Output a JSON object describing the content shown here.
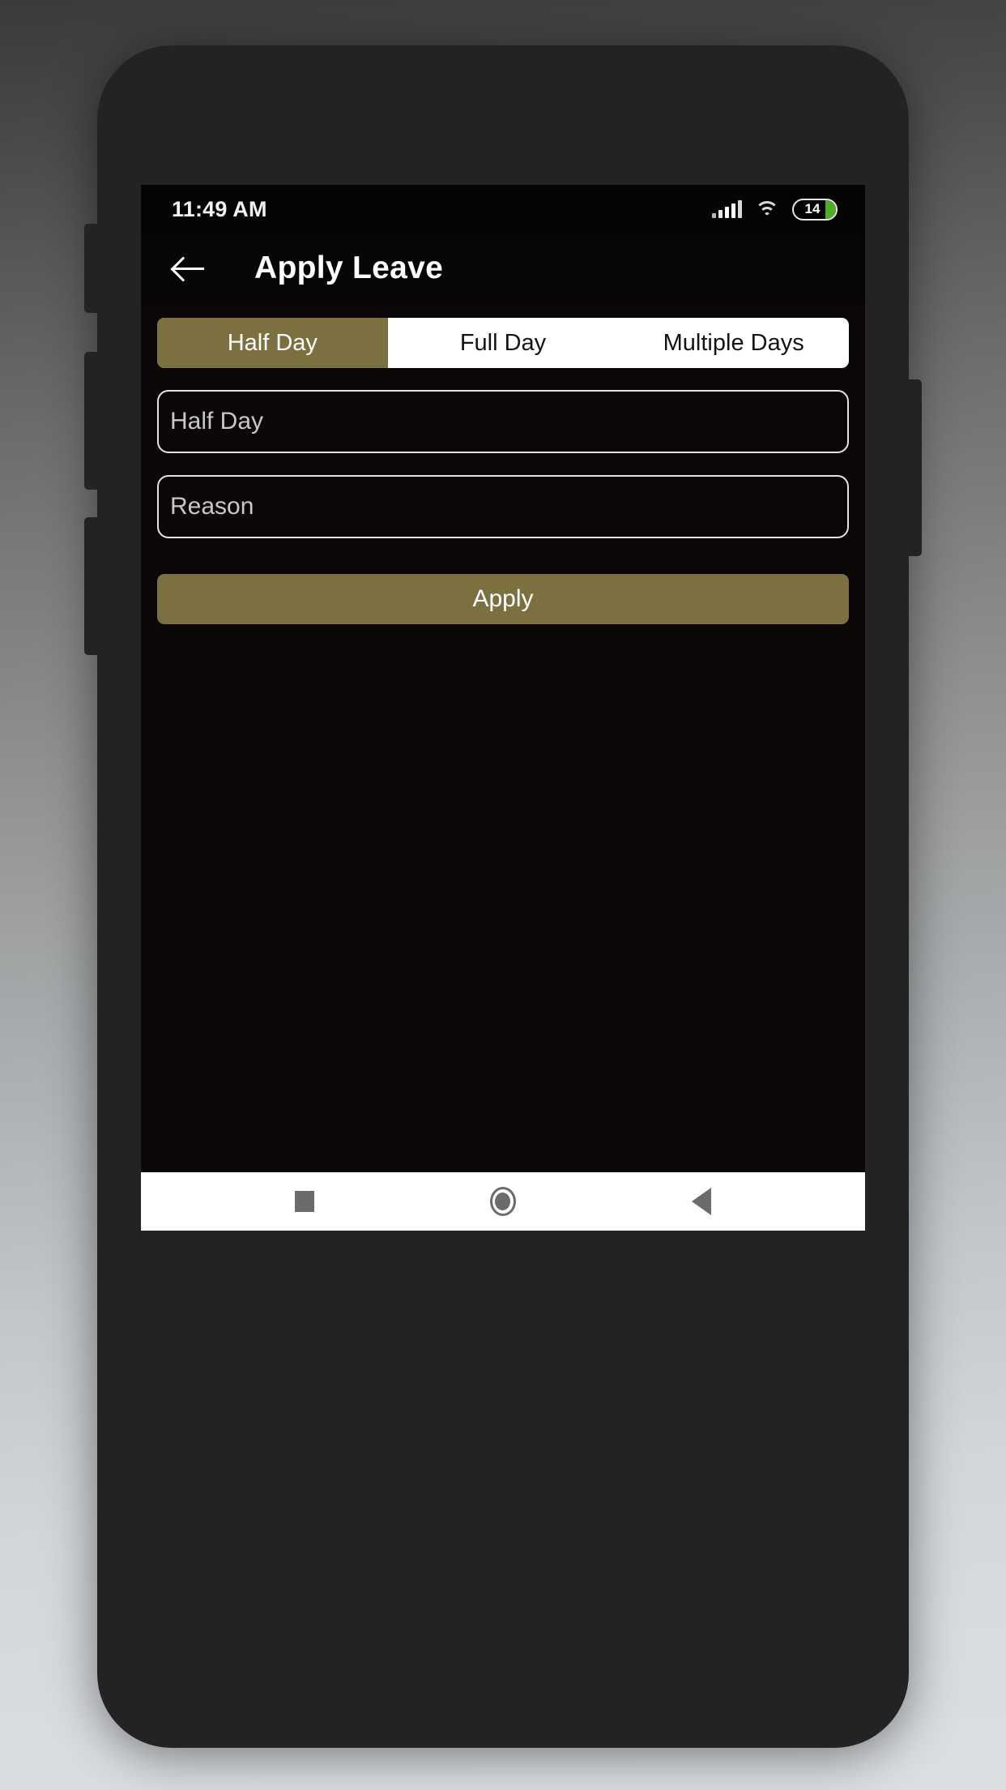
{
  "status_bar": {
    "time": "11:49 AM",
    "signal_icon": "signal-bars-icon",
    "wifi_icon": "wifi-icon",
    "battery_level": "14",
    "battery_icon": "battery-icon"
  },
  "app_bar": {
    "back_icon": "back-arrow-icon",
    "title": "Apply Leave"
  },
  "segmented_control": {
    "tabs": [
      {
        "label": "Half Day",
        "selected": true
      },
      {
        "label": "Full Day",
        "selected": false
      },
      {
        "label": "Multiple Days",
        "selected": false
      }
    ]
  },
  "form": {
    "fields": [
      {
        "name": "leave-type",
        "value": "",
        "placeholder": "Half Day"
      },
      {
        "name": "reason",
        "value": "",
        "placeholder": "Reason"
      }
    ],
    "submit_label": "Apply"
  },
  "nav_bar": {
    "recents_icon": "square-recents-icon",
    "home_icon": "circle-home-icon",
    "back_icon": "triangle-back-icon"
  },
  "colors": {
    "accent": "#7d7040",
    "screen_background": "#0a0706",
    "device_frame": "#232323",
    "battery_fill": "#4caf27",
    "nav_bar_background": "#ffffff",
    "nav_icon": "#6b6b6b"
  }
}
